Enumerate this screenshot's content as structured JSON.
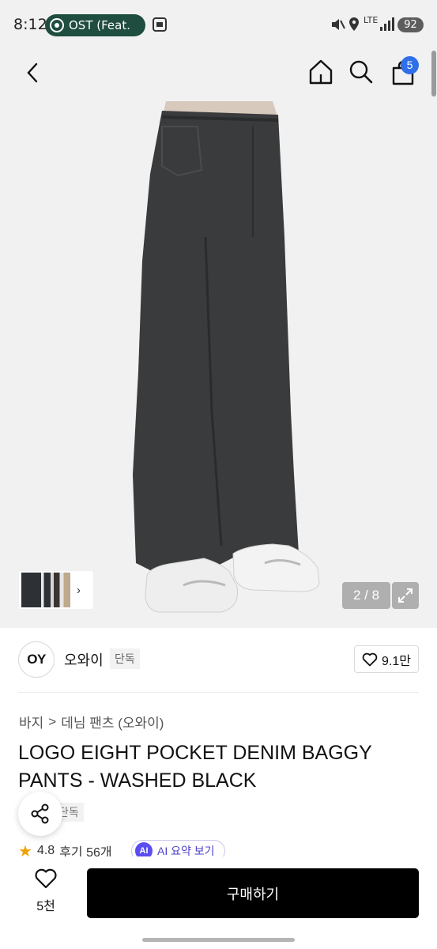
{
  "status_bar": {
    "time": "8:12",
    "media_text": "OST (Feat.",
    "network": "LTE",
    "battery": "92"
  },
  "gallery": {
    "pager": "2 / 8"
  },
  "header": {
    "cart_count": "5"
  },
  "brand": {
    "logo": "OY",
    "name": "오와이",
    "tag": "단독",
    "likes": "9.1만"
  },
  "breadcrumb": {
    "category": "바지",
    "separator": ">",
    "subcategory": "데님 팬츠 (오와이)"
  },
  "product": {
    "title": "LOGO EIGHT POCKET DENIM BAGGY PANTS - WASHED BLACK",
    "tag": "단독",
    "rating": "4.8",
    "reviews": "후기 56개",
    "ai_badge": "AI",
    "ai_summary": "AI 요약 보기"
  },
  "bottom": {
    "wish_count": "5천",
    "buy_label": "구매하기"
  },
  "colors": {
    "accent": "#2f6fe8",
    "buy_button": "#000000",
    "media_pill": "#1f4d3f"
  }
}
